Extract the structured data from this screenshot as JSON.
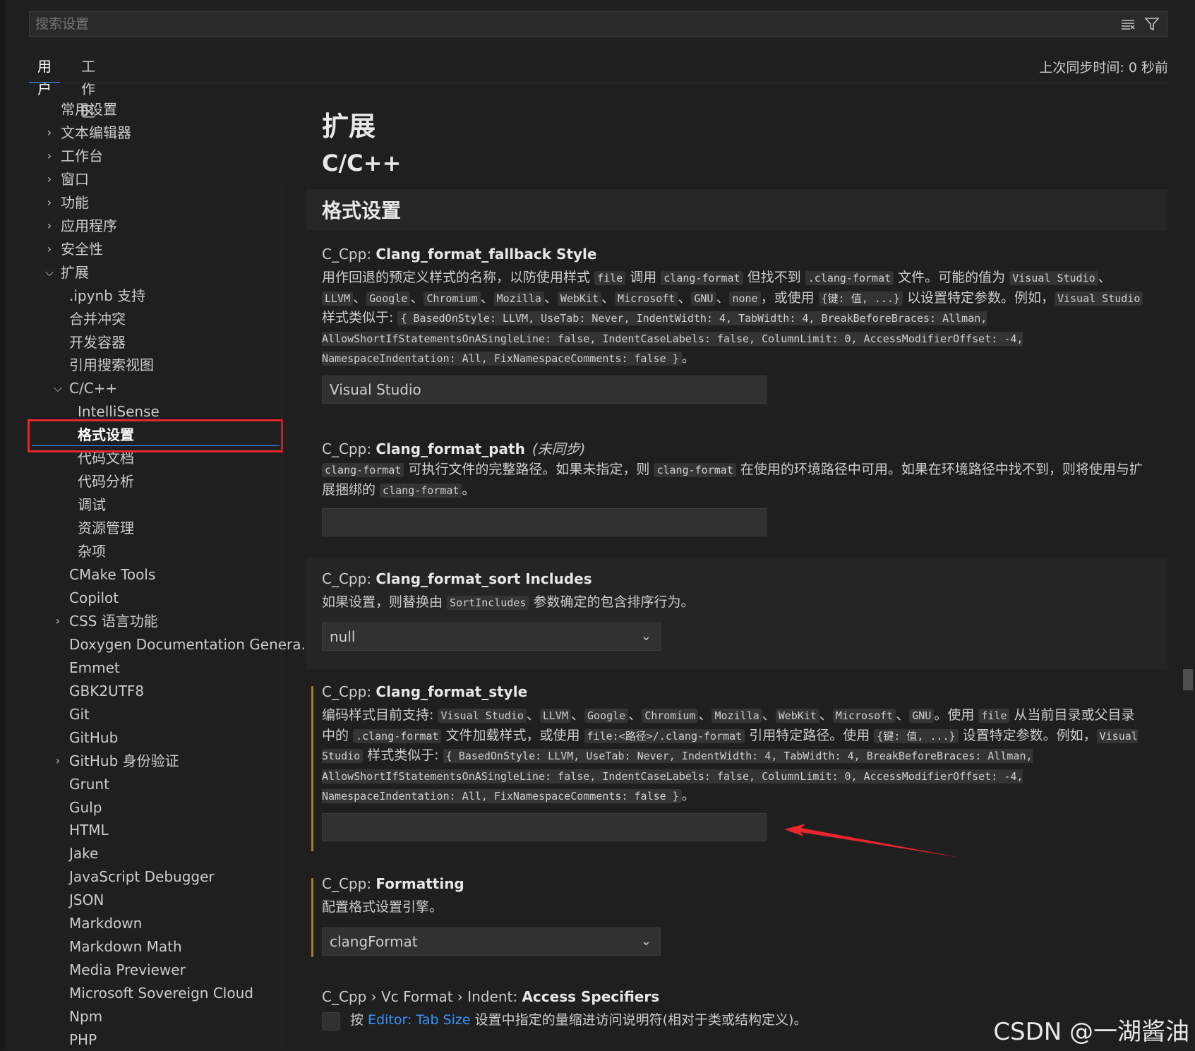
{
  "search": {
    "placeholder": "搜索设置"
  },
  "tabs": [
    {
      "label": "用户",
      "active": true
    },
    {
      "label": "工作区",
      "active": false
    }
  ],
  "sync_status": "上次同步时间: 0 秒前",
  "tree": {
    "items": [
      {
        "label": "常用设置"
      },
      {
        "label": "文本编辑器",
        "chevron": "right"
      },
      {
        "label": "工作台",
        "chevron": "right"
      },
      {
        "label": "窗口",
        "chevron": "right"
      },
      {
        "label": "功能",
        "chevron": "right"
      },
      {
        "label": "应用程序",
        "chevron": "right"
      },
      {
        "label": "安全性",
        "chevron": "right"
      },
      {
        "label": "扩展",
        "chevron": "down"
      },
      {
        "label": ".ipynb 支持"
      },
      {
        "label": "合并冲突"
      },
      {
        "label": "开发容器"
      },
      {
        "label": "引用搜索视图"
      },
      {
        "label": "C/C++",
        "chevron": "down"
      },
      {
        "label": "IntelliSense"
      },
      {
        "label": "格式设置",
        "selected": true
      },
      {
        "label": "代码文档"
      },
      {
        "label": "代码分析"
      },
      {
        "label": "调试"
      },
      {
        "label": "资源管理"
      },
      {
        "label": "杂项"
      },
      {
        "label": "CMake Tools"
      },
      {
        "label": "Copilot"
      },
      {
        "label": "CSS 语言功能",
        "chevron": "right"
      },
      {
        "label": "Doxygen Documentation Genera..."
      },
      {
        "label": "Emmet"
      },
      {
        "label": "GBK2UTF8"
      },
      {
        "label": "Git"
      },
      {
        "label": "GitHub"
      },
      {
        "label": "GitHub 身份验证",
        "chevron": "right"
      },
      {
        "label": "Grunt"
      },
      {
        "label": "Gulp"
      },
      {
        "label": "HTML"
      },
      {
        "label": "Jake"
      },
      {
        "label": "JavaScript Debugger"
      },
      {
        "label": "JSON"
      },
      {
        "label": "Markdown"
      },
      {
        "label": "Markdown Math"
      },
      {
        "label": "Media Previewer"
      },
      {
        "label": "Microsoft Sovereign Cloud"
      },
      {
        "label": "Npm"
      },
      {
        "label": "PHP"
      }
    ]
  },
  "headings": {
    "extension": "扩展",
    "cpp": "C/C++",
    "section": "格式设置"
  },
  "settings": {
    "fallback": {
      "prefix": "C_Cpp: ",
      "name": "Clang_format_fallback Style",
      "t1": "用作回退的预定义样式的名称，以防使用样式 ",
      "c1": "file",
      "t2": " 调用 ",
      "c2": "clang-format",
      "t3": " 但找不到 ",
      "c3": ".clang-format",
      "t4": " 文件。可能的值为 ",
      "c4": "Visual Studio",
      "t5": "、",
      "c5": "LLVM",
      "t6": "、",
      "c6": "Google",
      "t7": "、",
      "c7": "Chromium",
      "t8": "、",
      "c8": "Mozilla",
      "t9": "、",
      "c9": "WebKit",
      "t10": "、",
      "c10": "Microsoft",
      "t11": "、",
      "c11": "GNU",
      "t12": "、",
      "c12": "none",
      "t13": "，或使用 ",
      "c13": "{键: 值, ...}",
      "t14": " 以设置特定参数。例如，",
      "c14": "Visual Studio",
      "t15": " 样式类似于: ",
      "c15": "{ BasedOnStyle: LLVM, UseTab: Never, IndentWidth: 4, TabWidth: 4, BreakBeforeBraces: Allman, AllowShortIfStatementsOnASingleLine: false, IndentCaseLabels: false, ColumnLimit: 0, AccessModifierOffset: -4, NamespaceIndentation: All, FixNamespaceComments: false }",
      "t16": "。",
      "value": "Visual Studio"
    },
    "path": {
      "prefix": "C_Cpp: ",
      "name": "Clang_format_path",
      "note": "(未同步)",
      "c1": "clang-format",
      "t1": " 可执行文件的完整路径。如果未指定，则 ",
      "c2": "clang-format",
      "t2": " 在使用的环境路径中可用。如果在环境路径中找不到，则将使用与扩展捆绑的 ",
      "c3": "clang-format",
      "t3": "。",
      "value": ""
    },
    "sort": {
      "prefix": "C_Cpp: ",
      "name": "Clang_format_sort Includes",
      "t1": "如果设置，则替换由 ",
      "c1": "SortIncludes",
      "t2": " 参数确定的包含排序行为。",
      "value": "null"
    },
    "style": {
      "prefix": "C_Cpp: ",
      "name": "Clang_format_style",
      "t1": "编码样式目前支持: ",
      "c1": "Visual Studio",
      "t2": "、",
      "c2": "LLVM",
      "t3": "、",
      "c3": "Google",
      "t4": "、",
      "c4": "Chromium",
      "t5": "、",
      "c5": "Mozilla",
      "t6": "、",
      "c6": "WebKit",
      "t7": "、",
      "c7": "Microsoft",
      "t8": "、",
      "c8": "GNU",
      "t9": "。使用 ",
      "c9": "file",
      "t10": " 从当前目录或父目录中的 ",
      "c10": ".clang-format",
      "t11": " 文件加载样式，或使用 ",
      "c11": "file:<路径>/.clang-format",
      "t12": " 引用特定路径。使用 ",
      "c12": "{键: 值, ...}",
      "t13": " 设置特定参数。例如，",
      "c13": "Visual Studio",
      "t14": " 样式类似于: ",
      "c14": "{ BasedOnStyle: LLVM, UseTab: Never, IndentWidth: 4, TabWidth: 4, BreakBeforeBraces: Allman, AllowShortIfStatementsOnASingleLine: false, IndentCaseLabels: false, ColumnLimit: 0, AccessModifierOffset: -4, NamespaceIndentation: All, FixNamespaceComments: false }",
      "t15": "。",
      "value": ""
    },
    "formatting": {
      "prefix": "C_Cpp: ",
      "name": "Formatting",
      "desc": "配置格式设置引擎。",
      "value": "clangFormat"
    },
    "access": {
      "prefix": "C_Cpp › Vc Format › Indent: ",
      "name": "Access Specifiers",
      "t1": "按 ",
      "link": "Editor: Tab Size",
      "t2": " 设置中指定的量缩进访问说明符(相对于类或结构定义)。",
      "checked": false
    }
  },
  "watermark": "CSDN @一湖酱油",
  "colors": {
    "accent": "#3794ff",
    "selection_border": "#e8262b",
    "arrow": "#e8262b",
    "modified_bar": "#a67c2d"
  }
}
